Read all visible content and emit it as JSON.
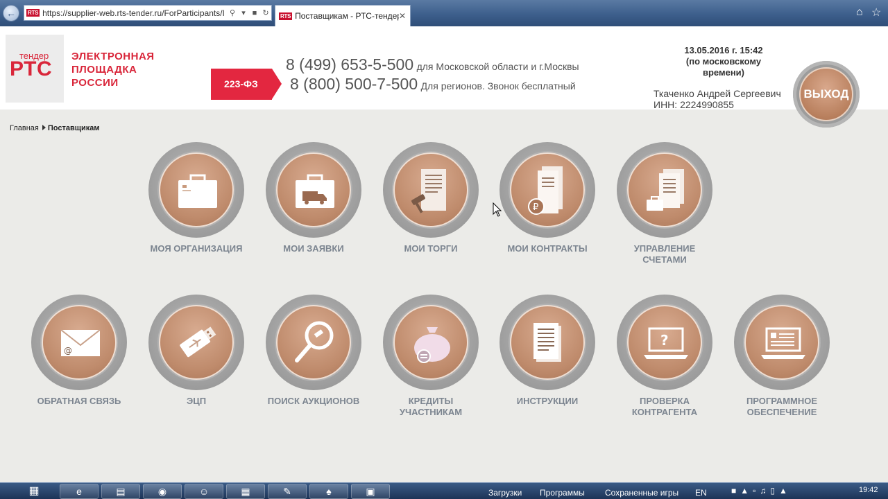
{
  "browser": {
    "address_url": "https://supplier-web.rts-tender.ru/ForParticipants/I",
    "favicon_text": "RTS",
    "tab_title": "Поставщикам - РТС-тендер"
  },
  "header": {
    "logo_top": "тендер",
    "logo_main": "РТС",
    "platform_name": "ЭЛЕКТРОННАЯ ПЛОЩАДКА РОССИИ",
    "law_badge": "223-ФЗ",
    "phone1": {
      "number": "8 (499) 653-5-500",
      "note": "для Московской области и г.Москвы"
    },
    "phone2": {
      "number": "8 (800) 500-7-500",
      "note": "Для регионов. Звонок бесплатный"
    },
    "datetime": "13.05.2016 г. 15:42",
    "timezone": "(по московскому времени)",
    "user_name": "Ткаченко Андрей Сергеевич",
    "user_inn": "ИНН: 2224990855",
    "logout": "ВЫХОД"
  },
  "breadcrumb": {
    "home": "Главная",
    "current": "Поставщикам"
  },
  "tiles": [
    {
      "label": "МОЯ ОРГАНИЗАЦИЯ",
      "icon": "briefcase-icon"
    },
    {
      "label": "МОИ ЗАЯВКИ",
      "icon": "truck-case-icon"
    },
    {
      "label": "МОИ ТОРГИ",
      "icon": "gavel-document-icon"
    },
    {
      "label": "МОИ КОНТРАКТЫ",
      "icon": "ruble-document-icon"
    },
    {
      "label": "УПРАВЛЕНИЕ СЧЕТАМИ",
      "icon": "account-documents-icon"
    },
    {
      "label": "ОБРАТНАЯ СВЯЗЬ",
      "icon": "envelope-icon"
    },
    {
      "label": "ЭЦП",
      "icon": "usb-key-icon"
    },
    {
      "label": "ПОИСК АУКЦИОНОВ",
      "icon": "magnifier-icon"
    },
    {
      "label": "КРЕДИТЫ УЧАСТНИКАМ",
      "icon": "money-bag-icon"
    },
    {
      "label": "ИНСТРУКЦИИ",
      "icon": "documents-icon"
    },
    {
      "label": "ПРОВЕРКА КОНТРАГЕНТА",
      "icon": "laptop-question-icon"
    },
    {
      "label": "ПРОГРАММНОЕ ОБЕСПЕЧЕНИЕ",
      "icon": "laptop-software-icon"
    }
  ],
  "taskbar": {
    "toolbar1": "Загрузки",
    "toolbar2": "Программы",
    "toolbar3": "Сохраненные игры",
    "lang": "EN",
    "clock": "19:42"
  }
}
